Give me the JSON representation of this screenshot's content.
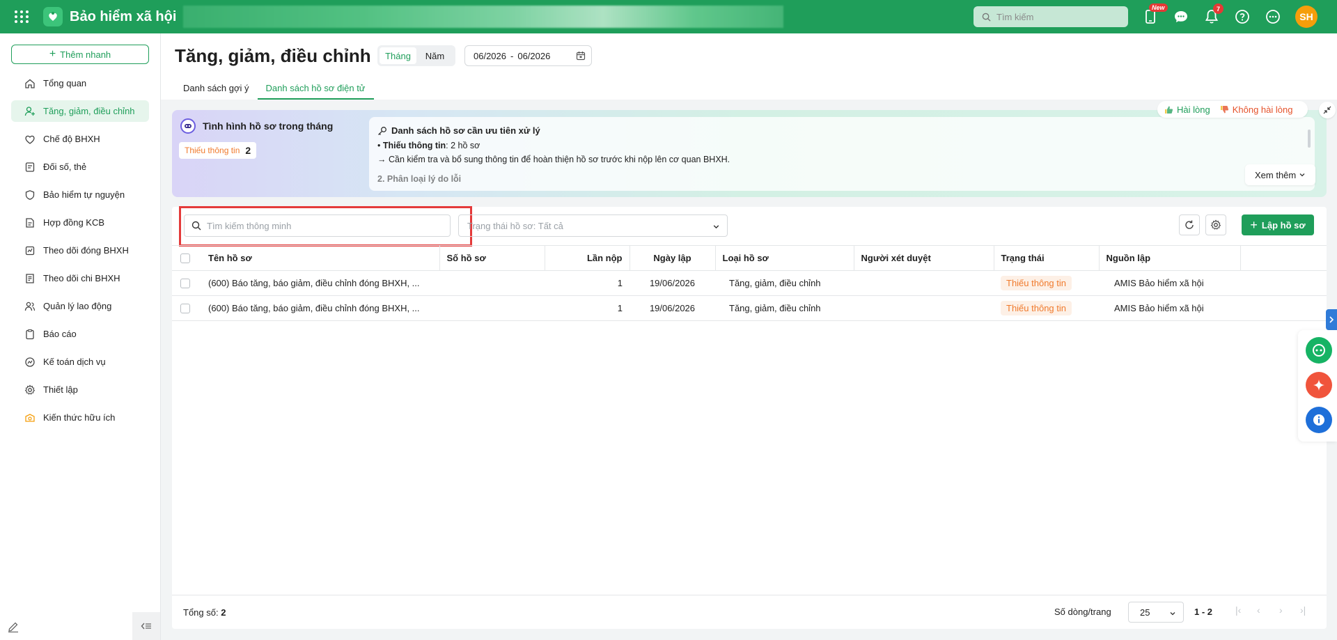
{
  "app": {
    "title": "Bảo hiểm xã hội",
    "search_placeholder": "Tìm kiếm",
    "new_badge": "New",
    "notification_count": "7",
    "avatar_initials": "SH"
  },
  "sidebar": {
    "quick_add": "Thêm nhanh",
    "items": [
      {
        "label": "Tổng quan",
        "icon": "home-icon"
      },
      {
        "label": "Tăng, giảm, điều chỉnh",
        "icon": "user-add-icon",
        "active": true
      },
      {
        "label": "Chế độ BHXH",
        "icon": "heart-icon"
      },
      {
        "label": "Đối số, thẻ",
        "icon": "card-icon"
      },
      {
        "label": "Bảo hiểm tự nguyện",
        "icon": "shield-icon"
      },
      {
        "label": "Hợp đồng KCB",
        "icon": "contract-icon"
      },
      {
        "label": "Theo dõi đóng BHXH",
        "icon": "tracking-icon"
      },
      {
        "label": "Theo dõi chi BHXH",
        "icon": "expense-icon"
      },
      {
        "label": "Quản lý lao động",
        "icon": "people-icon"
      },
      {
        "label": "Báo cáo",
        "icon": "report-icon"
      },
      {
        "label": "Kế toán dịch vụ",
        "icon": "accounting-icon"
      },
      {
        "label": "Thiết lập",
        "icon": "gear-icon"
      },
      {
        "label": "Kiến thức hữu ích",
        "icon": "knowledge-icon"
      }
    ]
  },
  "header": {
    "title": "Tăng, giảm, điều chỉnh",
    "period_month": "Tháng",
    "period_year": "Năm",
    "date_from": "06/2026",
    "date_sep": "-",
    "date_to": "06/2026",
    "tabs": [
      "Danh sách gợi ý",
      "Danh sách hồ sơ điện tử"
    ]
  },
  "ai_panel": {
    "title": "Tình hình hồ sơ trong tháng",
    "missing_label": "Thiếu thông tin",
    "missing_count": "2",
    "priority_title": "Danh sách hồ sơ cần ưu tiên xử lý",
    "line1_bold": "Thiếu thông tin",
    "line1_rest": ": 2 hồ sơ",
    "line2": "→ Cần kiểm tra và bổ sung thông tin để hoàn thiện hồ sơ trước khi nộp lên cơ quan BHXH.",
    "line3": "2. Phân loại lý do lỗi",
    "see_more": "Xem thêm",
    "like": "Hài lòng",
    "dislike": "Không hài lòng"
  },
  "toolbar": {
    "search_placeholder": "Tìm kiếm thông minh",
    "status_filter": "Trạng thái hồ sơ: Tất cả",
    "create": "Lập hồ sơ"
  },
  "table": {
    "columns": [
      "Tên hồ sơ",
      "Số hồ sơ",
      "Lần nộp",
      "Ngày lập",
      "Loại hồ sơ",
      "Người xét duyệt",
      "Trạng thái",
      "Nguồn lập"
    ],
    "rows": [
      {
        "name": "(600) Báo tăng, báo giảm, điều chỉnh đóng BHXH, ...",
        "number": "",
        "submit": "1",
        "date": "19/06/2026",
        "type": "Tăng, giảm, điều chỉnh",
        "reviewer": "",
        "status": "Thiếu thông tin",
        "source": "AMIS Bảo hiểm xã hội"
      },
      {
        "name": "(600) Báo tăng, báo giảm, điều chỉnh đóng BHXH, ...",
        "number": "",
        "submit": "1",
        "date": "19/06/2026",
        "type": "Tăng, giảm, điều chỉnh",
        "reviewer": "",
        "status": "Thiếu thông tin",
        "source": "AMIS Bảo hiểm xã hội"
      }
    ]
  },
  "footer": {
    "total_label": "Tổng số:",
    "total": "2",
    "rows_label": "Số dòng/trang",
    "rows_value": "25",
    "range": "1 - 2"
  },
  "colors": {
    "brand": "#1f9e5a",
    "warning": "#f07a2c",
    "highlight": "#e43a3a"
  }
}
